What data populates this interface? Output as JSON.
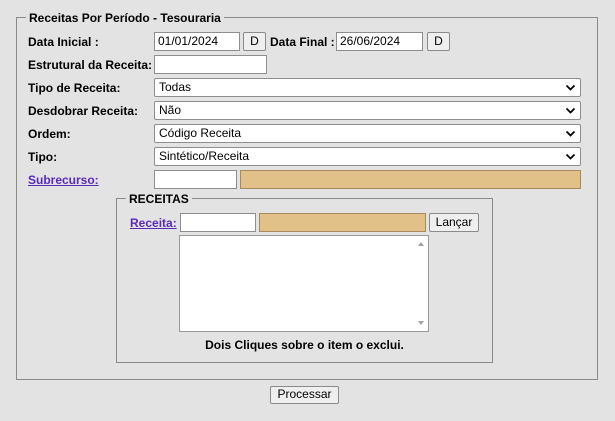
{
  "fieldset": {
    "legend": "Receitas Por Período - Tesouraria"
  },
  "labels": {
    "data_inicial": "Data Inicial :",
    "data_final": "Data Final :",
    "estrutural": "Estrutural da Receita:",
    "tipo_receita": "Tipo de Receita:",
    "desdobrar": "Desdobrar Receita:",
    "ordem": "Ordem:",
    "tipo": "Tipo:",
    "subrecurso": "Subrecurso:"
  },
  "fields": {
    "data_inicial": "01/01/2024",
    "data_final": "26/06/2024",
    "estrutural": "",
    "subrecurso_code": "",
    "receita_code": ""
  },
  "buttons": {
    "date_picker": "D",
    "lancar": "Lançar",
    "processar": "Processar"
  },
  "selects": {
    "tipo_receita": "Todas",
    "desdobrar": "Não",
    "ordem": "Código Receita",
    "tipo": "Sintético/Receita"
  },
  "receitas": {
    "legend": "RECEITAS",
    "label": "Receita:",
    "hint": "Dois Cliques sobre o item o exclui."
  },
  "colors": {
    "readonly": "#e2c189",
    "link": "#5a2ab8"
  }
}
